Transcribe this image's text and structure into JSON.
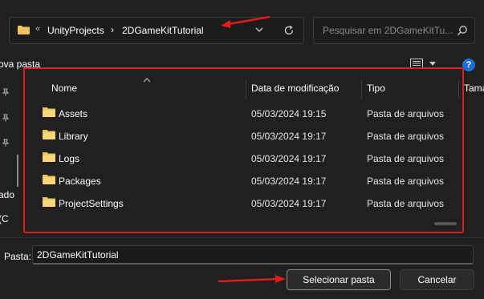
{
  "address_bar": {
    "overflow_glyph": "«",
    "crumbs": [
      "UnityProjects",
      "2DGameKitTutorial"
    ],
    "separator": "›"
  },
  "search": {
    "placeholder": "Pesquisar em 2DGameKitTu..."
  },
  "toolbar": {
    "new_folder_label": "ova pasta",
    "help_label": "?"
  },
  "nav_pane": {
    "items": [
      "ado",
      "(C"
    ]
  },
  "file_list": {
    "columns": [
      "Nome",
      "Data de modificação",
      "Tipo",
      "Tama"
    ],
    "rows": [
      {
        "name": "Assets",
        "date": "05/03/2024 19:15",
        "type": "Pasta de arquivos",
        "icon": "folder-icon"
      },
      {
        "name": "Library",
        "date": "05/03/2024 19:17",
        "type": "Pasta de arquivos",
        "icon": "folder-icon"
      },
      {
        "name": "Logs",
        "date": "05/03/2024 19:17",
        "type": "Pasta de arquivos",
        "icon": "folder-icon"
      },
      {
        "name": "Packages",
        "date": "05/03/2024 19:17",
        "type": "Pasta de arquivos",
        "icon": "folder-icon"
      },
      {
        "name": "ProjectSettings",
        "date": "05/03/2024 19:17",
        "type": "Pasta de arquivos",
        "icon": "folder-icon"
      }
    ]
  },
  "footer": {
    "folder_label": "Pasta:",
    "folder_value": "2DGameKitTutorial",
    "select_button": "Selecionar pasta",
    "cancel_button": "Cancelar"
  },
  "colors": {
    "background": "#202020",
    "annotation_red": "#e21b1b",
    "folder_yellow": "#f2c55c",
    "help_blue": "#1f6fd6"
  }
}
